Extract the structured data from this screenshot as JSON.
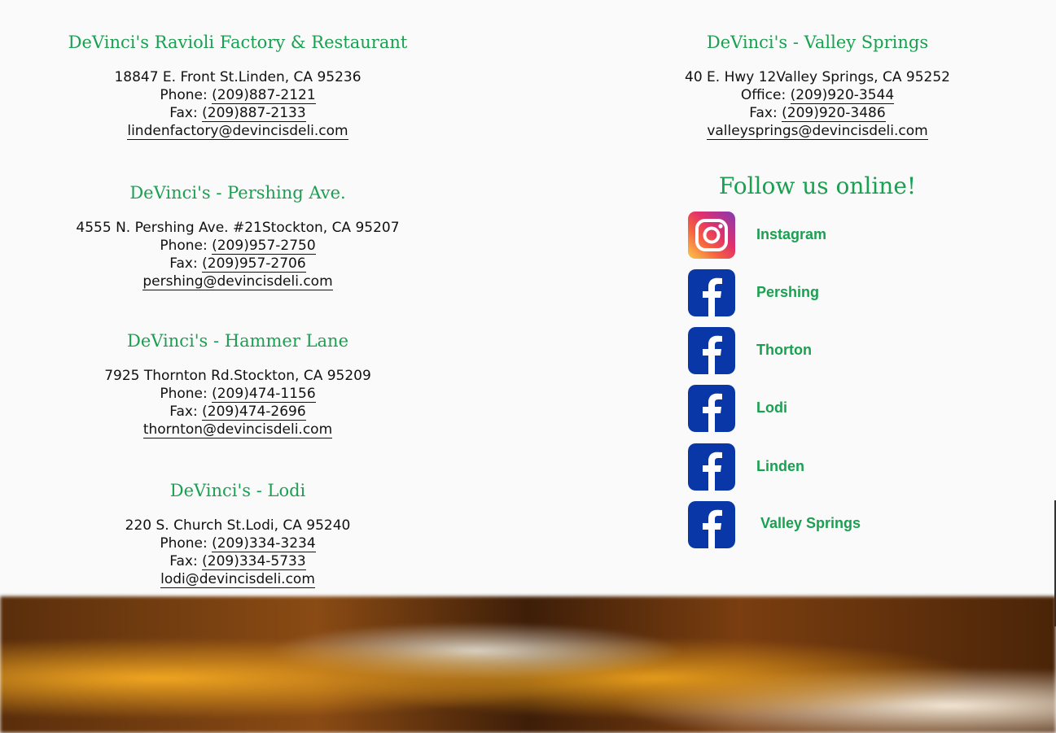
{
  "locations": [
    {
      "title": "DeVinci's Ravioli Factory & Restaurant",
      "address": "18847 E. Front St.Linden, CA 95236",
      "phone_label": "Phone: ",
      "phone": "(209)887-2121",
      "fax_label": "Fax: ",
      "fax": "(209)887-2133",
      "email": "lindenfactory@devincisdeli.com"
    },
    {
      "title": "DeVinci's - Pershing Ave.",
      "address": "4555 N. Pershing Ave. #21Stockton, CA 95207",
      "phone_label": "Phone: ",
      "phone": "(209)957-2750",
      "fax_label": "Fax: ",
      "fax": "(209)957-2706",
      "email": "pershing@devincisdeli.com"
    },
    {
      "title": "DeVinci's - Hammer Lane",
      "address": "7925 Thornton Rd.Stockton, CA 95209",
      "phone_label": "Phone: ",
      "phone": "(209)474-1156",
      "fax_label": "Fax: ",
      "fax": "(209)474-2696",
      "email": "thornton@devincisdeli.com"
    },
    {
      "title": "DeVinci's - Lodi",
      "address": "220 S. Church St.Lodi, CA 95240",
      "phone_label": "Phone: ",
      "phone": "(209)334-3234",
      "fax_label": "Fax: ",
      "fax": "(209)334-5733",
      "email": "lodi@devincisdeli.com"
    },
    {
      "title": "DeVinci's - Valley Springs",
      "address": "40 E. Hwy 12Valley Springs, CA 95252",
      "phone_label": "Office: ",
      "phone": "(209)920-3544",
      "fax_label": "Fax: ",
      "fax": "(209)920-3486",
      "email": "valleysprings@devincisdeli.com"
    }
  ],
  "follow": {
    "title": "Follow us online!",
    "links": [
      {
        "label": "Instagram",
        "icon": "instagram-icon"
      },
      {
        "label": "Pershing",
        "icon": "facebook-icon"
      },
      {
        "label": "Thorton",
        "icon": "facebook-icon"
      },
      {
        "label": "Lodi",
        "icon": "facebook-icon"
      },
      {
        "label": "Linden",
        "icon": "facebook-icon"
      },
      {
        "label": "Valley Springs",
        "icon": "facebook-icon"
      }
    ]
  },
  "colors": {
    "accent": "#1aa051",
    "facebook": "#0a37a7"
  }
}
